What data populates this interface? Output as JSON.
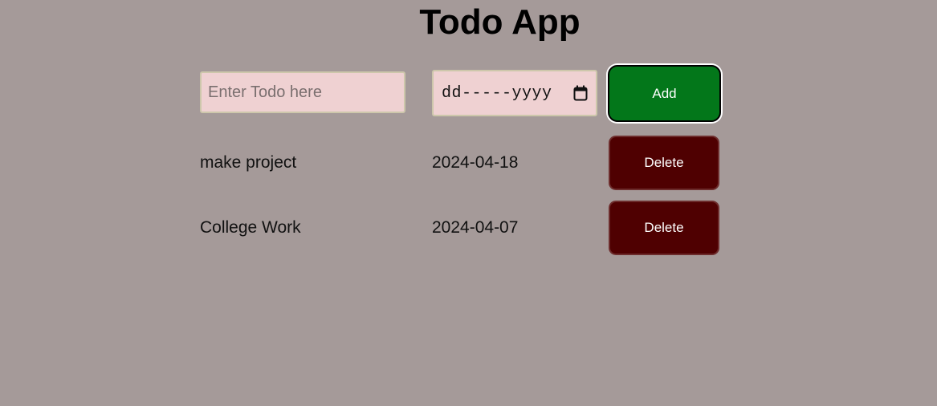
{
  "app": {
    "title": "Todo App"
  },
  "form": {
    "todo_placeholder": "Enter Todo here",
    "todo_value": "",
    "date_placeholder": "dd-----yyyy",
    "add_label": "Add"
  },
  "todos": [
    {
      "name": "make project",
      "date": "2024-04-18",
      "delete_label": "Delete"
    },
    {
      "name": "College Work",
      "date": "2024-04-07",
      "delete_label": "Delete"
    }
  ],
  "colors": {
    "background": "#a59a99",
    "input_bg": "#efd1d2",
    "add_button": "#03771a",
    "delete_button": "#4f0001"
  },
  "icons": {
    "date_picker": "calendar-icon"
  }
}
